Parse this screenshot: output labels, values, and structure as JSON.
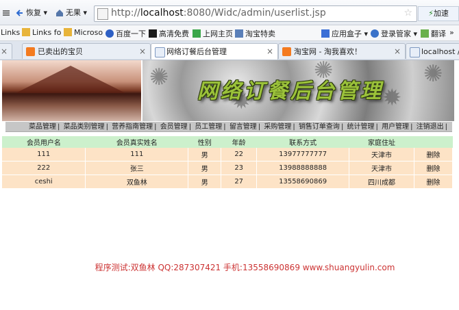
{
  "browser": {
    "back_label": "恢复",
    "dropdown_label": "无果",
    "url_prefix": "http://",
    "url_host": "localhost",
    "url_rest": ":8080/Widc/admin/userlist.jsp",
    "speed_label": "加速",
    "favorites": [
      "Links",
      "Links fo",
      "Microso",
      "百度一下",
      "高清免费",
      "上网主页",
      "淘宝特卖",
      "应用盒子",
      "登录管家",
      "翻译"
    ],
    "tabs": [
      {
        "label": "已卖出的宝贝",
        "active": false
      },
      {
        "label": "网络订餐后台管理",
        "active": true
      },
      {
        "label": "淘宝网 - 淘我喜欢！",
        "active": false
      },
      {
        "label": "localhost /",
        "active": false
      }
    ]
  },
  "banner": {
    "title": "网络订餐后台管理"
  },
  "menu": [
    "菜品管理",
    "菜品类别管理",
    "营养指南管理",
    "会员管理",
    "员工管理",
    "留言管理",
    "采购管理",
    "销售订单查询",
    "统计管理",
    "用户管理",
    "注销退出"
  ],
  "table": {
    "headers": [
      "会员用户名",
      "会员真实姓名",
      "性别",
      "年龄",
      "联系方式",
      "家庭住址",
      ""
    ],
    "rows": [
      {
        "username": "111",
        "realname": "111",
        "gender": "男",
        "age": "22",
        "phone": "13977777777",
        "address": "天津市",
        "action": "删除"
      },
      {
        "username": "222",
        "realname": "张三",
        "gender": "男",
        "age": "23",
        "phone": "13988888888",
        "address": "天津市",
        "action": "删除"
      },
      {
        "username": "ceshi",
        "realname": "双鱼林",
        "gender": "男",
        "age": "27",
        "phone": "13558690869",
        "address": "四川成都",
        "action": "删除"
      }
    ]
  },
  "footer": {
    "text": "程序测试:双鱼林 QQ:287307421 手机:13558690869 www.shuangyulin.com"
  }
}
